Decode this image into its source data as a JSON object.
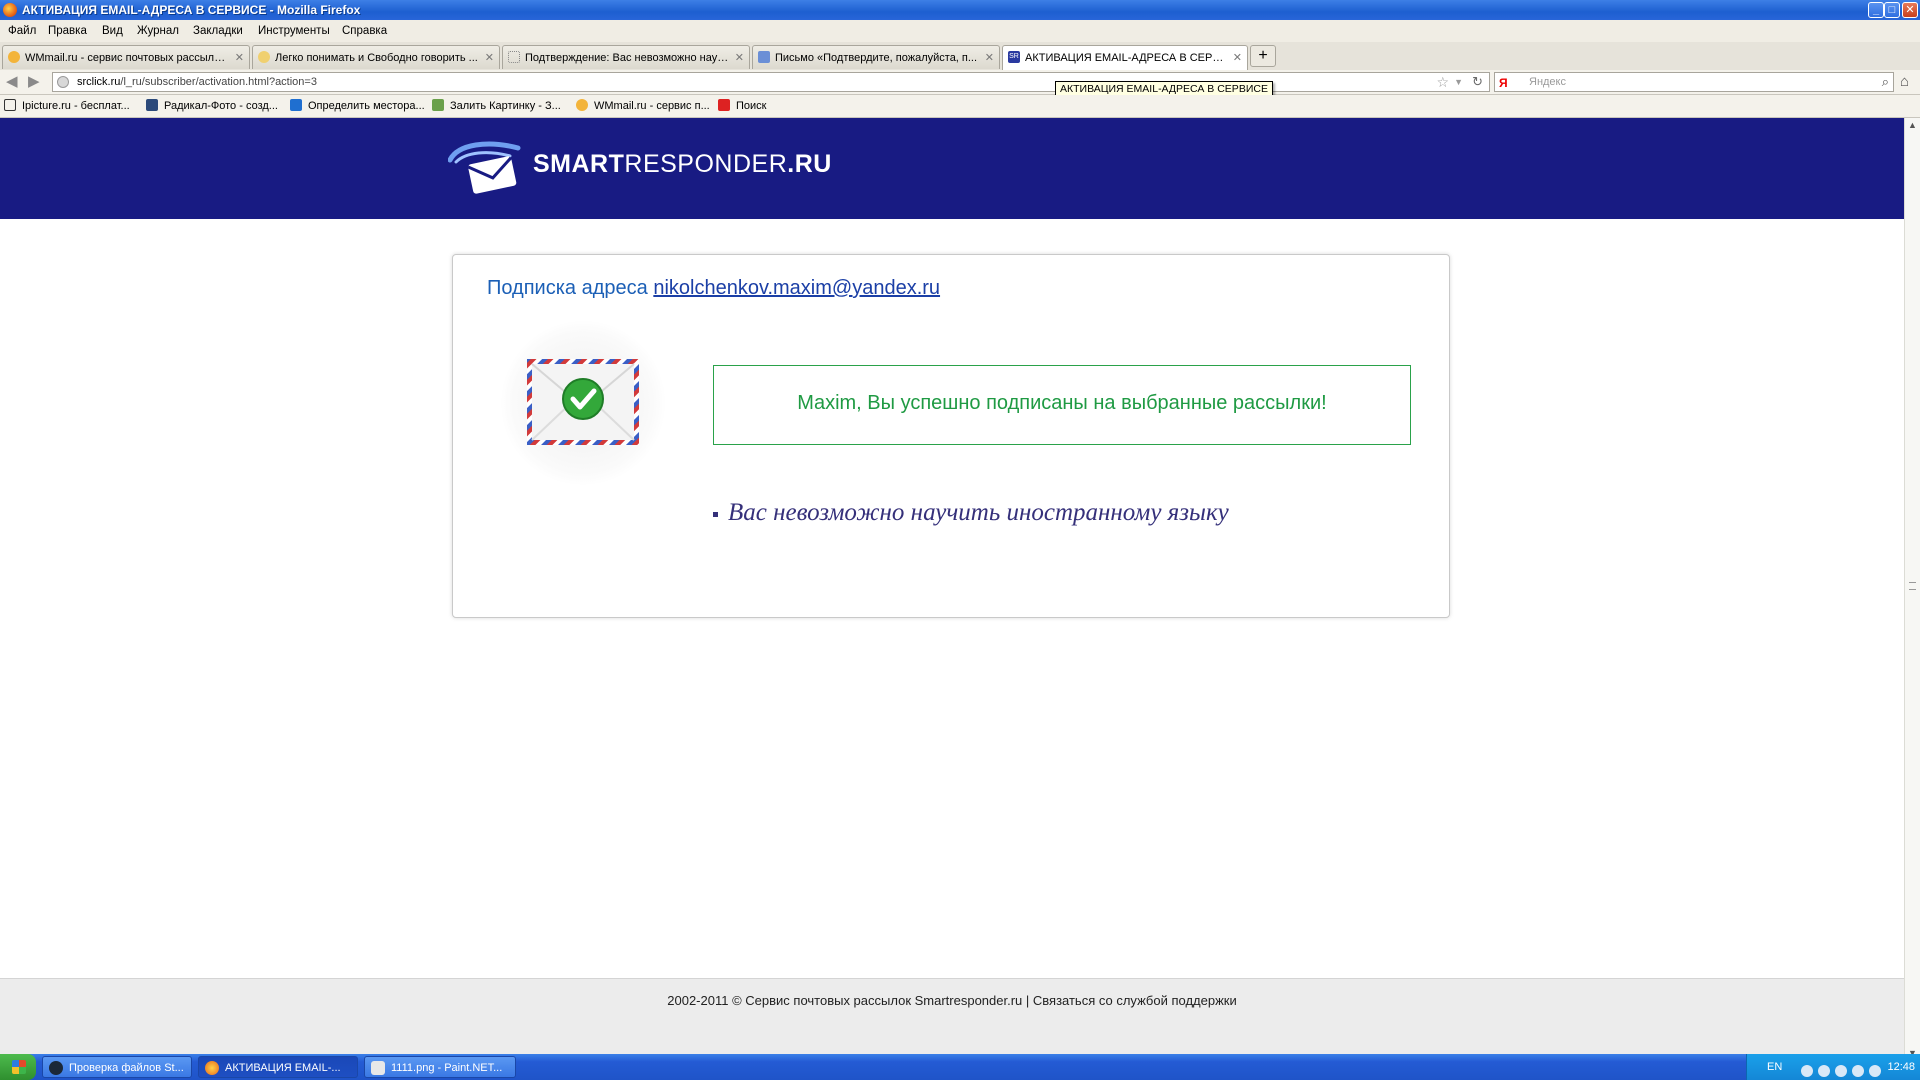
{
  "window": {
    "title": "АКТИВАЦИЯ EMAIL-АДРЕСА В СЕРВИСЕ - Mozilla Firefox",
    "buttons": {
      "minimize": "_",
      "maximize": "□",
      "close": "✕"
    }
  },
  "menu": {
    "items": [
      "Файл",
      "Правка",
      "Вид",
      "Журнал",
      "Закладки",
      "Инструменты",
      "Справка"
    ]
  },
  "tabs": [
    {
      "label": "WMmail.ru - сервис почтовых рассылок...",
      "icon": "wmmail-icon",
      "active": false
    },
    {
      "label": "Легко понимать и Свободно говорить ...",
      "icon": "page-icon",
      "active": false
    },
    {
      "label": "Подтверждение: Вас невозможно науч...",
      "icon": "blank-page-icon",
      "active": false
    },
    {
      "label": "Письмо «Подтвердите, пожалуйста, п...",
      "icon": "mail-icon",
      "active": false
    },
    {
      "label": "АКТИВАЦИЯ EMAIL-АДРЕСА В СЕРВИСЕ",
      "icon": "sr-icon",
      "active": true
    }
  ],
  "new_tab_label": "+",
  "nav": {
    "back": "◀",
    "forward": "▶",
    "url_domain": "srclick.ru",
    "url_path": "/l_ru/subscriber/activation.html?action=3",
    "bookmark_star": "☆",
    "dropdown": "▼",
    "reload": "↻",
    "search_engine": "Я",
    "search_placeholder": "Яндекс",
    "search_go": "⌕",
    "home": "⌂"
  },
  "tooltip": "АКТИВАЦИЯ EMAIL-АДРЕСА В СЕРВИСЕ",
  "bookmarks": [
    {
      "label": "Ipicture.ru - бесплат...",
      "icon": "ipicture-icon"
    },
    {
      "label": "Радикал-Фото - созд...",
      "icon": "radikal-icon"
    },
    {
      "label": "Определить местора...",
      "icon": "ip-icon"
    },
    {
      "label": "Залить Картинку - З...",
      "icon": "image-host-icon"
    },
    {
      "label": "WMmail.ru - сервис п...",
      "icon": "wmmail-icon"
    },
    {
      "label": "Поиск",
      "icon": "search-bookmark-icon"
    }
  ],
  "page": {
    "logo": {
      "strong": "SMART",
      "light": "RESPONDER",
      "suffix": ".RU"
    },
    "subscription_prefix": "Подписка адреса ",
    "subscription_email": "nikolchenkov.maxim@yandex.ru",
    "success_message": "Maxim, Вы успешно подписаны на выбранные рассылки!",
    "list_name": "Вас невозможно научить иностранному языку",
    "footer_text": "2002-2011 © Сервис почтовых рассылок Smartresponder.ru | Связаться со службой поддержки"
  },
  "taskbar": {
    "items": [
      {
        "label": "Проверка файлов St...",
        "icon": "steam-icon",
        "active": false
      },
      {
        "label": "АКТИВАЦИЯ EMAIL-...",
        "icon": "firefox-icon",
        "active": true
      },
      {
        "label": "1111.png - Paint.NET...",
        "icon": "paintnet-icon",
        "active": false
      }
    ],
    "language": "EN",
    "clock": "12:48"
  },
  "colors": {
    "header_bg": "#181b83",
    "success_green": "#1f9a43",
    "link_blue": "#1b3fa6",
    "list_purple": "#35307a"
  }
}
